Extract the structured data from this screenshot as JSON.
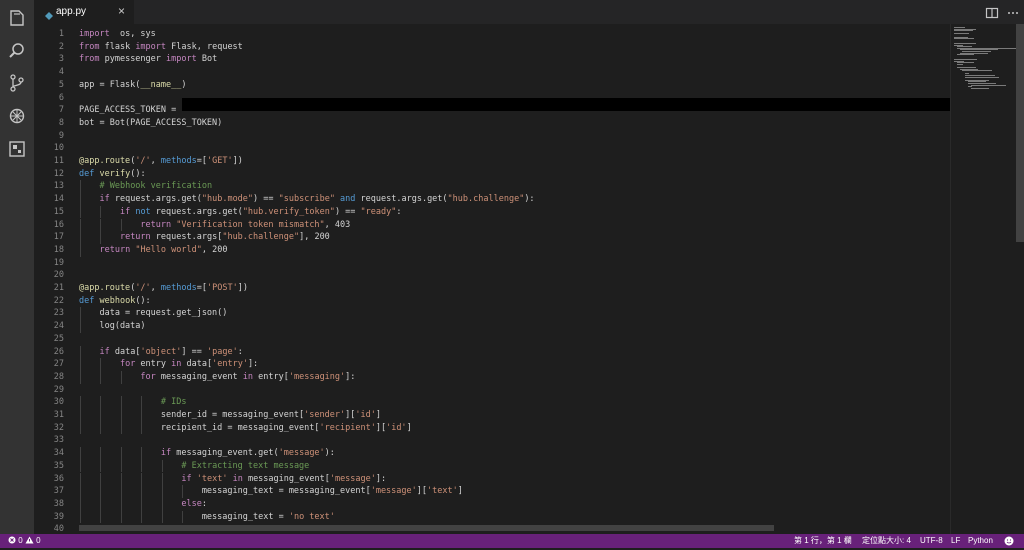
{
  "editor_tab": {
    "title": "app.py",
    "close_glyph": "×",
    "icon": "python-file-icon"
  },
  "activity_bar": [
    {
      "name": "explorer-icon"
    },
    {
      "name": "search-icon"
    },
    {
      "name": "source-control-icon"
    },
    {
      "name": "debug-icon"
    },
    {
      "name": "extensions-icon"
    }
  ],
  "code_lines": [
    [
      [
        "kw",
        "import"
      ],
      [
        "",
        "  os, sys"
      ]
    ],
    [
      [
        "kw",
        "from"
      ],
      [
        "",
        " flask "
      ],
      [
        "kw",
        "import"
      ],
      [
        "",
        " Flask, request"
      ]
    ],
    [
      [
        "kw",
        "from"
      ],
      [
        "",
        " pymessenger "
      ],
      [
        "kw",
        "import"
      ],
      [
        "",
        " Bot"
      ]
    ],
    [],
    [
      [
        "",
        "app = Flask("
      ],
      [
        "dd",
        "__name__"
      ],
      [
        "",
        ")"
      ]
    ],
    [],
    [
      [
        "",
        "PAGE_ACCESS_TOKEN = "
      ]
    ],
    [
      [
        "",
        "bot = Bot(PAGE_ACCESS_TOKEN)"
      ]
    ],
    [],
    [],
    [
      [
        "fn",
        "@app.route"
      ],
      [
        "",
        "("
      ],
      [
        "str",
        "'/'"
      ],
      [
        "",
        ", "
      ],
      [
        "kb",
        "methods"
      ],
      [
        "",
        "=["
      ],
      [
        "str",
        "'GET'"
      ],
      [
        "",
        "])"
      ]
    ],
    [
      [
        "kb",
        "def"
      ],
      [
        "",
        " "
      ],
      [
        "fn",
        "verify"
      ],
      [
        "",
        "():"
      ]
    ],
    [
      [
        "",
        "    "
      ],
      [
        "cm",
        "# Webhook verification"
      ]
    ],
    [
      [
        "",
        "    "
      ],
      [
        "kw",
        "if"
      ],
      [
        "",
        " request.args.get("
      ],
      [
        "str",
        "\"hub.mode\""
      ],
      [
        "",
        ") == "
      ],
      [
        "str",
        "\"subscribe\""
      ],
      [
        "",
        ""
      ],
      [
        "kb",
        " and"
      ],
      [
        "",
        " request.args.get("
      ],
      [
        "str",
        "\"hub.challenge\""
      ],
      [
        "",
        "):"
      ]
    ],
    [
      [
        "",
        "        "
      ],
      [
        "kw",
        "if"
      ],
      [
        "kb",
        " not"
      ],
      [
        "",
        " request.args.get("
      ],
      [
        "str",
        "\"hub.verify_token\""
      ],
      [
        "",
        ") == "
      ],
      [
        "str",
        "\"ready\""
      ],
      [
        "",
        ":"
      ]
    ],
    [
      [
        "",
        "            "
      ],
      [
        "kw",
        "return"
      ],
      [
        "",
        " "
      ],
      [
        "str",
        "\"Verification token mismatch\""
      ],
      [
        "",
        ", 403"
      ]
    ],
    [
      [
        "",
        "        "
      ],
      [
        "kw",
        "return"
      ],
      [
        "",
        " request.args["
      ],
      [
        "str",
        "\"hub.challenge\""
      ],
      [
        "",
        "], 200"
      ]
    ],
    [
      [
        "",
        "    "
      ],
      [
        "kw",
        "return"
      ],
      [
        "",
        " "
      ],
      [
        "str",
        "\"Hello world\""
      ],
      [
        "",
        ", 200"
      ]
    ],
    [],
    [],
    [
      [
        "fn",
        "@app.route"
      ],
      [
        "",
        "("
      ],
      [
        "str",
        "'/'"
      ],
      [
        "",
        ", "
      ],
      [
        "kb",
        "methods"
      ],
      [
        "",
        "=["
      ],
      [
        "str",
        "'POST'"
      ],
      [
        "",
        "])"
      ]
    ],
    [
      [
        "kb",
        "def"
      ],
      [
        "",
        " "
      ],
      [
        "fn",
        "webhook"
      ],
      [
        "",
        "():"
      ]
    ],
    [
      [
        "",
        "    data = request.get_json()"
      ]
    ],
    [
      [
        "",
        "    log(data)"
      ]
    ],
    [],
    [
      [
        "",
        "    "
      ],
      [
        "kw",
        "if"
      ],
      [
        "",
        " data["
      ],
      [
        "str",
        "'object'"
      ],
      [
        "",
        "] == "
      ],
      [
        "str",
        "'page'"
      ],
      [
        "",
        ":"
      ]
    ],
    [
      [
        "",
        "        "
      ],
      [
        "kw",
        "for"
      ],
      [
        "",
        " entry "
      ],
      [
        "kw",
        "in"
      ],
      [
        "",
        " data["
      ],
      [
        "str",
        "'entry'"
      ],
      [
        "",
        "]:"
      ]
    ],
    [
      [
        "",
        "            "
      ],
      [
        "kw",
        "for"
      ],
      [
        "",
        " messaging_event "
      ],
      [
        "kw",
        "in"
      ],
      [
        "",
        " entry["
      ],
      [
        "str",
        "'messaging'"
      ],
      [
        "",
        "]:"
      ]
    ],
    [],
    [
      [
        "",
        "                "
      ],
      [
        "cm",
        "# IDs"
      ]
    ],
    [
      [
        "",
        "                sender_id = messaging_event["
      ],
      [
        "str",
        "'sender'"
      ],
      [
        "",
        "]["
      ],
      [
        "str",
        "'id'"
      ],
      [
        "",
        "]"
      ]
    ],
    [
      [
        "",
        "                recipient_id = messaging_event["
      ],
      [
        "str",
        "'recipient'"
      ],
      [
        "",
        "]["
      ],
      [
        "str",
        "'id'"
      ],
      [
        "",
        "]"
      ]
    ],
    [],
    [
      [
        "",
        "                "
      ],
      [
        "kw",
        "if"
      ],
      [
        "",
        " messaging_event.get("
      ],
      [
        "str",
        "'message'"
      ],
      [
        "",
        "):"
      ]
    ],
    [
      [
        "",
        "                    "
      ],
      [
        "cm",
        "# Extracting text message"
      ]
    ],
    [
      [
        "",
        "                    "
      ],
      [
        "kw",
        "if"
      ],
      [
        "",
        " "
      ],
      [
        "str",
        "'text'"
      ],
      [
        "",
        " "
      ],
      [
        "kw",
        "in"
      ],
      [
        "",
        " messaging_event["
      ],
      [
        "str",
        "'message'"
      ],
      [
        "",
        "]:"
      ]
    ],
    [
      [
        "",
        "                        messaging_text = messaging_event["
      ],
      [
        "str",
        "'message'"
      ],
      [
        "",
        "]["
      ],
      [
        "str",
        "'text'"
      ],
      [
        "",
        "]"
      ]
    ],
    [
      [
        "",
        "                    "
      ],
      [
        "kw",
        "else"
      ],
      [
        "",
        ":"
      ]
    ],
    [
      [
        "",
        "                        messaging_text = "
      ],
      [
        "str",
        "'no text'"
      ]
    ],
    []
  ],
  "status_bar": {
    "errors": "0",
    "warnings": "0",
    "position": "第 1 行，第 1 欄",
    "indent": "定位點大小: 4",
    "encoding": "UTF-8",
    "eol": "LF",
    "language": "Python",
    "feedback_icon": "smiley-icon"
  },
  "colors": {
    "status_bar": "#68217a",
    "editor_bg": "#1e1e1e",
    "keyword": "#c586c0",
    "builtin": "#569cd6",
    "string": "#ce9178",
    "comment": "#6a9955",
    "function": "#dcdcaa"
  }
}
